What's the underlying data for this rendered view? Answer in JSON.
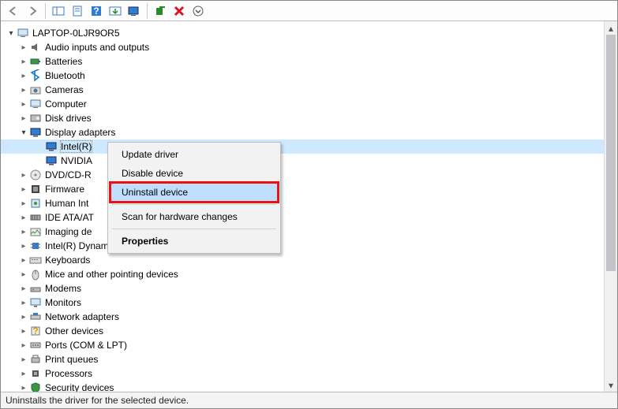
{
  "toolbar": {
    "back": "Back",
    "forward": "Forward",
    "show_hidden": "Show hidden",
    "properties_btn": "Properties",
    "help": "Help",
    "update": "Update",
    "scan": "Scan",
    "add": "Add legacy",
    "remove": "Remove",
    "more": "More"
  },
  "root": {
    "name": "LAPTOP-0LJR9OR5"
  },
  "categories": [
    {
      "label": "Audio inputs and outputs",
      "icon": "speaker-icon",
      "expanded": false
    },
    {
      "label": "Batteries",
      "icon": "battery-icon",
      "expanded": false
    },
    {
      "label": "Bluetooth",
      "icon": "bluetooth-icon",
      "expanded": false
    },
    {
      "label": "Cameras",
      "icon": "camera-icon",
      "expanded": false
    },
    {
      "label": "Computer",
      "icon": "computer-icon",
      "expanded": false
    },
    {
      "label": "Disk drives",
      "icon": "disk-icon",
      "expanded": false
    },
    {
      "label": "Display adapters",
      "icon": "display-icon",
      "expanded": true,
      "children": [
        {
          "label": "Intel(R)",
          "icon": "display-icon",
          "selected": true
        },
        {
          "label": "NVIDIA",
          "icon": "display-icon"
        }
      ]
    },
    {
      "label": "DVD/CD-R",
      "icon": "optical-icon",
      "expanded": false,
      "truncated": true
    },
    {
      "label": "Firmware",
      "icon": "firmware-icon",
      "expanded": false
    },
    {
      "label": "Human Int",
      "icon": "hid-icon",
      "expanded": false,
      "truncated": true
    },
    {
      "label": "IDE ATA/AT",
      "icon": "ide-icon",
      "expanded": false,
      "truncated": true
    },
    {
      "label": "Imaging de",
      "icon": "imaging-icon",
      "expanded": false,
      "truncated": true
    },
    {
      "label": "Intel(R) Dynamic Platform and Thermal Framework",
      "icon": "chip-icon",
      "expanded": false
    },
    {
      "label": "Keyboards",
      "icon": "keyboard-icon",
      "expanded": false
    },
    {
      "label": "Mice and other pointing devices",
      "icon": "mouse-icon",
      "expanded": false
    },
    {
      "label": "Modems",
      "icon": "modem-icon",
      "expanded": false
    },
    {
      "label": "Monitors",
      "icon": "monitor-icon",
      "expanded": false
    },
    {
      "label": "Network adapters",
      "icon": "network-icon",
      "expanded": false
    },
    {
      "label": "Other devices",
      "icon": "other-icon",
      "expanded": false
    },
    {
      "label": "Ports (COM & LPT)",
      "icon": "port-icon",
      "expanded": false
    },
    {
      "label": "Print queues",
      "icon": "printer-icon",
      "expanded": false
    },
    {
      "label": "Processors",
      "icon": "cpu-icon",
      "expanded": false
    },
    {
      "label": "Security devices",
      "icon": "security-icon",
      "expanded": false
    }
  ],
  "context_menu": {
    "items": [
      {
        "label": "Update driver"
      },
      {
        "label": "Disable device"
      },
      {
        "label": "Uninstall device",
        "highlight": true,
        "annotated": true
      },
      {
        "sep": true
      },
      {
        "label": "Scan for hardware changes"
      },
      {
        "sep": true
      },
      {
        "label": "Properties",
        "bold": true
      }
    ]
  },
  "status_text": "Uninstalls the driver for the selected device.",
  "annotation_color": "#e11919"
}
